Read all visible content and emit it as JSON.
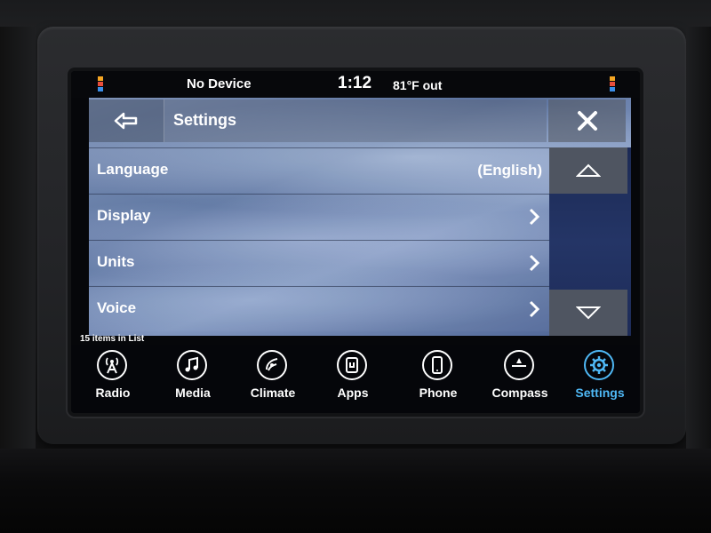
{
  "status": {
    "device": "No Device",
    "time": "1:12",
    "temperature": "81°F out"
  },
  "header": {
    "title": "Settings",
    "back_icon": "back-arrow-icon",
    "close_icon": "close-x-icon"
  },
  "list": {
    "items": [
      {
        "label": "Language",
        "value": "(English)"
      },
      {
        "label": "Display",
        "value": ""
      },
      {
        "label": "Units",
        "value": ""
      },
      {
        "label": "Voice",
        "value": ""
      }
    ],
    "count_text": "15 items in List"
  },
  "nav": {
    "items": [
      {
        "label": "Radio",
        "icon": "radio-tower-icon"
      },
      {
        "label": "Media",
        "icon": "music-note-icon"
      },
      {
        "label": "Climate",
        "icon": "climate-fan-icon"
      },
      {
        "label": "Apps",
        "icon": "apps-icon"
      },
      {
        "label": "Phone",
        "icon": "phone-icon"
      },
      {
        "label": "Compass",
        "icon": "compass-icon"
      },
      {
        "label": "Settings",
        "icon": "gear-icon"
      }
    ],
    "active": "Settings"
  },
  "colors": {
    "accent": "#4fb8f5",
    "text": "#ffffff"
  }
}
